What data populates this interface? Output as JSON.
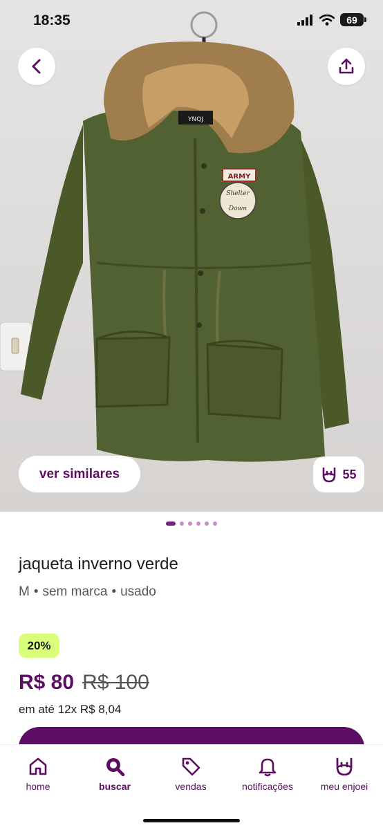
{
  "status_bar": {
    "time": "18:35",
    "battery": "69"
  },
  "photo": {
    "similar_label": "ver similares",
    "likes_count": "55",
    "label_text": "YNQJ",
    "patch_top": "ARMY",
    "patch_lines": [
      "Shelter",
      "Down"
    ]
  },
  "gallery": {
    "total": 6,
    "active": 0
  },
  "product": {
    "title": "jaqueta inverno verde",
    "size": "M",
    "brand": "sem marca",
    "condition": "usado",
    "separator": "•",
    "discount": "20%",
    "price": "R$ 80",
    "old_price": "R$ 100",
    "installments": "em até 12x R$ 8,04"
  },
  "colors": {
    "brand": "#5b0e62",
    "discount_bg": "#d9ff7a",
    "jacket": "#4f5e2a"
  },
  "nav": {
    "items": [
      {
        "label": "home",
        "icon": "home-icon"
      },
      {
        "label": "buscar",
        "icon": "search-icon",
        "active": true
      },
      {
        "label": "vendas",
        "icon": "tag-icon"
      },
      {
        "label": "notificações",
        "icon": "bell-icon"
      },
      {
        "label": "meu enjoei",
        "icon": "enjoei-hand-icon"
      }
    ]
  }
}
